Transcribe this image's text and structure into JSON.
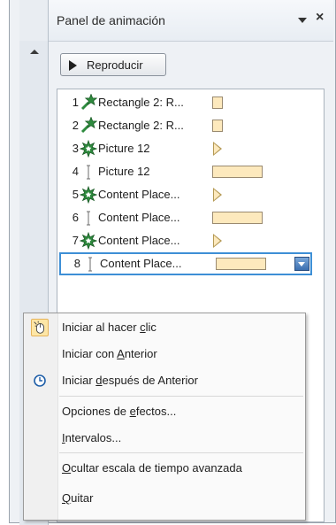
{
  "pane": {
    "title": "Panel de animación",
    "dropdown_icon": "chevron-down-icon",
    "close_label": "×",
    "play_button": {
      "label": "Reproducir",
      "icon": "play-icon"
    }
  },
  "animation_list": [
    {
      "num": "1",
      "label": "Rectangle 2: R...",
      "effect_icon": "entrance-star-icon",
      "timeline": "box-small"
    },
    {
      "num": "2",
      "label": "Rectangle 2: R...",
      "effect_icon": "entrance-star-icon",
      "timeline": "box-small"
    },
    {
      "num": "3",
      "label": "Picture 12",
      "effect_icon": "emphasis-star-icon",
      "timeline": "triangle"
    },
    {
      "num": "4",
      "label": "Picture 12",
      "effect_icon": "after-previous-bar-icon",
      "timeline": "box-large"
    },
    {
      "num": "5",
      "label": "Content Place...",
      "effect_icon": "emphasis-star-icon",
      "timeline": "triangle"
    },
    {
      "num": "6",
      "label": "Content Place...",
      "effect_icon": "after-previous-bar-icon",
      "timeline": "box-large"
    },
    {
      "num": "7",
      "label": "Content Place...",
      "effect_icon": "emphasis-star-icon",
      "timeline": "triangle"
    },
    {
      "num": "8",
      "label": "Content Place...",
      "effect_icon": "after-previous-bar-icon",
      "timeline": "box-large",
      "selected": true
    }
  ],
  "context_menu": {
    "items": [
      {
        "pre": "Iniciar al hacer ",
        "key": "c",
        "post": "lic",
        "icon": "mouse-click-icon",
        "checked": true
      },
      {
        "pre": "Iniciar con ",
        "key": "A",
        "post": "nterior",
        "icon": ""
      },
      {
        "pre": "Iniciar ",
        "key": "d",
        "post": "espués de Anterior",
        "icon": "clock-icon"
      },
      {
        "pre": "Opciones de ",
        "key": "e",
        "post": "fectos...",
        "icon": ""
      },
      {
        "pre": "",
        "key": "I",
        "post": "ntervalos...",
        "icon": ""
      },
      {
        "pre": "",
        "key": "O",
        "post": "cultar escala de tiempo avanzada",
        "icon": ""
      },
      {
        "pre": "",
        "key": "Q",
        "post": "uitar",
        "icon": ""
      }
    ]
  },
  "colors": {
    "selection_border": "#3d8fd6",
    "timeline_fill": "#fde9bd",
    "star_green": "#2e8b3e"
  }
}
